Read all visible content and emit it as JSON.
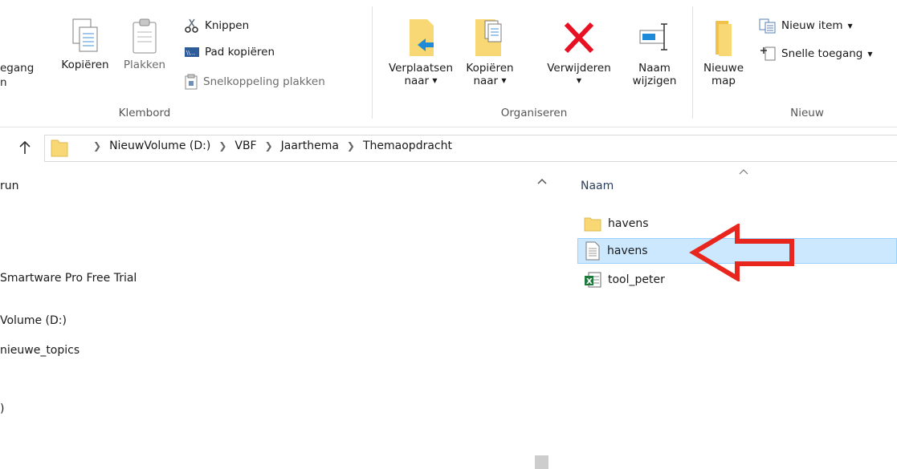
{
  "ribbon": {
    "clipboard": {
      "partial_label_top": "egang",
      "partial_label_bottom": "n",
      "copy_label": "Kopiëren",
      "paste_label": "Plakken",
      "cut_label": "Knippen",
      "copy_path_label": "Pad kopiëren",
      "paste_shortcut_label": "Snelkoppeling plakken",
      "group_label": "Klembord"
    },
    "organize": {
      "move_to_line1": "Verplaatsen",
      "move_to_line2": "naar",
      "copy_to_line1": "Kopiëren",
      "copy_to_line2": "naar",
      "delete_label": "Verwijderen",
      "rename_line1": "Naam",
      "rename_line2": "wijzigen",
      "group_label": "Organiseren"
    },
    "new": {
      "new_folder_line1": "Nieuwe",
      "new_folder_line2": "map",
      "new_item_label": "Nieuw item",
      "easy_access_label": "Snelle toegang",
      "group_label": "Nieuw"
    }
  },
  "address": {
    "crumbs": [
      "NieuwVolume (D:)",
      "VBF",
      "Jaarthema",
      "Themaopdracht"
    ]
  },
  "nav": {
    "items": [
      "run",
      "Smartware Pro Free Trial",
      "Volume (D:)",
      "nieuwe_topics",
      ")"
    ]
  },
  "files": {
    "column_name": "Naam",
    "items": [
      {
        "name": "havens",
        "type": "folder"
      },
      {
        "name": "havens",
        "type": "text-file",
        "selected": true
      },
      {
        "name": "tool_peter",
        "type": "excel-file"
      }
    ]
  },
  "colors": {
    "selection_bg": "#cce8ff",
    "selection_border": "#99d1ff",
    "delete_red": "#e81123",
    "folder_yellow": "#f8d775",
    "arrow_red": "#e8261d"
  }
}
